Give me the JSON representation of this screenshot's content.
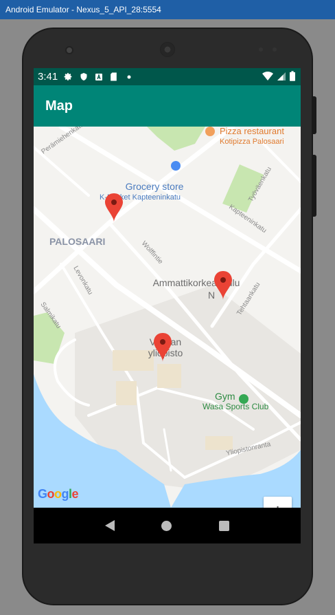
{
  "window": {
    "title": "Android Emulator - Nexus_5_API_28:5554"
  },
  "status_bar": {
    "time": "3:41"
  },
  "app_bar": {
    "title": "Map"
  },
  "map": {
    "places": {
      "pizza_name": "Pizza restaurant",
      "pizza_sub": "Kotipizza Palosaari",
      "grocery_name": "Grocery store",
      "grocery_sub": "K-Market Kapteeninkatu",
      "district": "PALOSAARI",
      "amk_line1": "Ammattikorkeakoulu",
      "amk_line2": "N",
      "uni_line1": "Vaasan",
      "uni_line2": "yliopisto",
      "gym_name": "Gym",
      "gym_sub": "Wasa Sports Club"
    },
    "streets": {
      "s1": "Perämiehenkatu",
      "s2": "Työväenkatu",
      "s3": "Kapteeninkatu",
      "s4": "Wolffintie",
      "s5": "Levonkatu",
      "s6": "Tehtaankatu",
      "s7": "Salmikatu",
      "s8": "Yliopistonranta"
    },
    "zoom_in_label": "+",
    "zoom_out_label": "−",
    "attribution": "Google",
    "colors": {
      "marker": "#ea4335",
      "water": "#aadaff",
      "park": "#c8e6b0",
      "road": "#ffffff",
      "campus": "#e8e6e2"
    }
  }
}
